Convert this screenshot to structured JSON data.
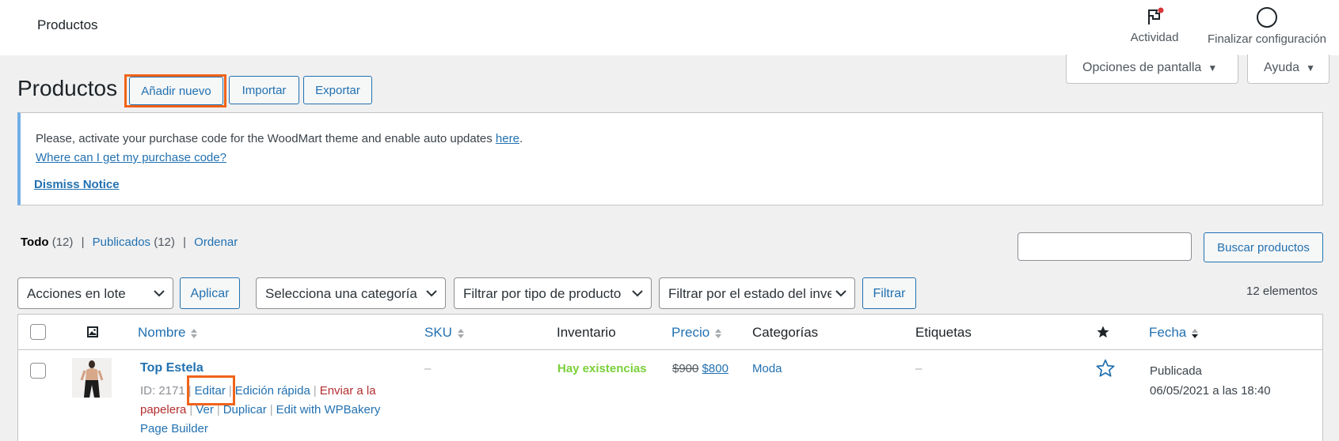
{
  "topbar": {
    "title": "Productos",
    "activity_label": "Actividad",
    "finish_label": "Finalizar configuración"
  },
  "screen_options": {
    "label": "Opciones de pantalla",
    "help_label": "Ayuda"
  },
  "header": {
    "title": "Productos",
    "add_new": "Añadir nuevo",
    "import": "Importar",
    "export": "Exportar"
  },
  "notice": {
    "line1": "Please, activate your purchase code for the WoodMart theme and enable auto updates ",
    "line1_link": "here",
    "line1_end": ".",
    "line2_link": "Where can I get my purchase code?",
    "dismiss": "Dismiss Notice"
  },
  "views": {
    "all": "Todo",
    "all_count": "(12)",
    "published": "Publicados",
    "published_count": "(12)",
    "sort": "Ordenar",
    "separator": "|"
  },
  "search": {
    "value": "",
    "button": "Buscar productos"
  },
  "filters": {
    "bulk_actions": "Acciones en lote",
    "apply": "Aplicar",
    "category": "Selecciona una categoría",
    "product_type": "Filtrar por tipo de producto",
    "stock_status": "Filtrar por el estado del inventario",
    "filter": "Filtrar",
    "items_count": "12 elementos"
  },
  "table": {
    "columns": {
      "name": "Nombre",
      "sku": "SKU",
      "stock": "Inventario",
      "price": "Precio",
      "categories": "Categorías",
      "tags": "Etiquetas",
      "date": "Fecha"
    },
    "rows": [
      {
        "name": "Top Estela",
        "id": "ID: 2171",
        "edit": "Editar",
        "quick_edit": "Edición rápida",
        "trash": "Enviar a la papelera",
        "view": "Ver",
        "duplicate": "Duplicar",
        "wpbakery": "Edit with WPBakery Page Builder",
        "sku": "–",
        "stock": "Hay existencias",
        "regular_price": "$900",
        "sale_price": "$800",
        "category": "Moda",
        "tags": "–",
        "status": "Publicada",
        "date": "06/05/2021 a las 18:40"
      }
    ]
  },
  "colors": {
    "accent": "#2271b1",
    "highlight": "#f06319",
    "in_stock": "#7ad03a",
    "trash": "#b32d2e",
    "notice_border": "#72aee6"
  }
}
